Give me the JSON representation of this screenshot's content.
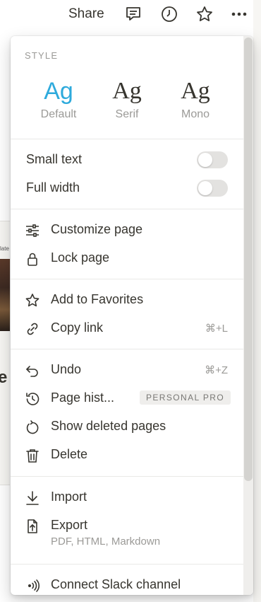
{
  "topbar": {
    "share_label": "Share",
    "icons": [
      "comment-icon",
      "clock-icon",
      "star-icon",
      "more-icon"
    ]
  },
  "background": {
    "card_text": "late",
    "heading_fragment": "e"
  },
  "menu": {
    "style_section_label": "STYLE",
    "style_options": [
      {
        "glyph": "Ag",
        "caption": "Default",
        "selected": true
      },
      {
        "glyph": "Ag",
        "caption": "Serif",
        "selected": false
      },
      {
        "glyph": "Ag",
        "caption": "Mono",
        "selected": false
      }
    ],
    "toggles": [
      {
        "label": "Small text",
        "on": false
      },
      {
        "label": "Full width",
        "on": false
      }
    ],
    "page_items": [
      {
        "label": "Customize page",
        "icon": "sliders-icon"
      },
      {
        "label": "Lock page",
        "icon": "lock-icon"
      }
    ],
    "share_items": [
      {
        "label": "Add to Favorites",
        "icon": "star-icon"
      },
      {
        "label": "Copy link",
        "icon": "link-icon",
        "shortcut": "⌘+L"
      }
    ],
    "history_items": [
      {
        "label": "Undo",
        "icon": "undo-icon",
        "shortcut": "⌘+Z"
      },
      {
        "label": "Page hist...",
        "icon": "history-icon",
        "badge": "PERSONAL PRO"
      },
      {
        "label": "Show deleted pages",
        "icon": "restore-icon"
      },
      {
        "label": "Delete",
        "icon": "trash-icon"
      }
    ],
    "io_items": [
      {
        "label": "Import",
        "icon": "download-icon"
      },
      {
        "label": "Export",
        "icon": "export-icon",
        "subtext": "PDF, HTML, Markdown"
      }
    ],
    "integration_items": [
      {
        "label": "Connect Slack channel",
        "icon": "slack-broadcast-icon"
      }
    ],
    "colors": {
      "accent": "#2eaadc",
      "text": "#37352f",
      "muted": "#9b9a97",
      "toggle_off": "#e3e2e0"
    }
  }
}
